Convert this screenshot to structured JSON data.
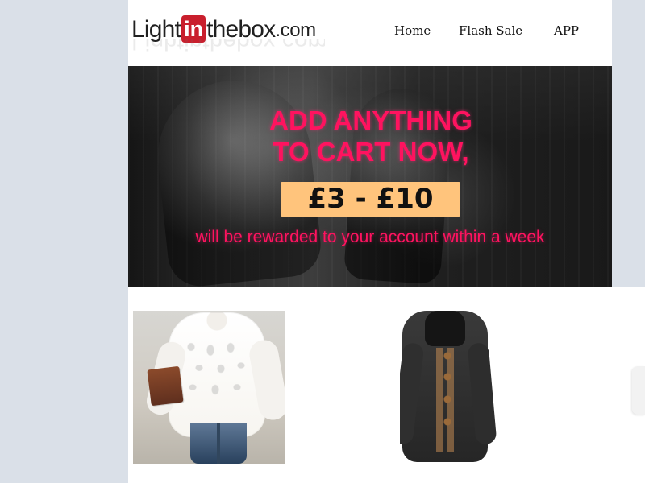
{
  "header": {
    "logo_parts": {
      "pre": "Light",
      "mid": "in",
      "post": "thebox",
      "dotcom": ".com"
    },
    "nav_items": [
      {
        "label": "Home"
      },
      {
        "label": "Flash Sale"
      },
      {
        "label": "APP"
      }
    ]
  },
  "banner": {
    "headline": "ADD ANYTHING\nTO CART NOW,",
    "price": "£3 - £10",
    "subline": "will be rewarded to your account within a week"
  },
  "colors": {
    "page_background": "#dae0e8",
    "header_background": "#ffffff",
    "banner_text": "#ff135f",
    "price_box": "#ffc47c",
    "logo_red": "#c91f2d"
  },
  "products": [
    {
      "image_name": "white-knit-sweater-image"
    },
    {
      "image_name": "dark-cardigan-image"
    }
  ]
}
